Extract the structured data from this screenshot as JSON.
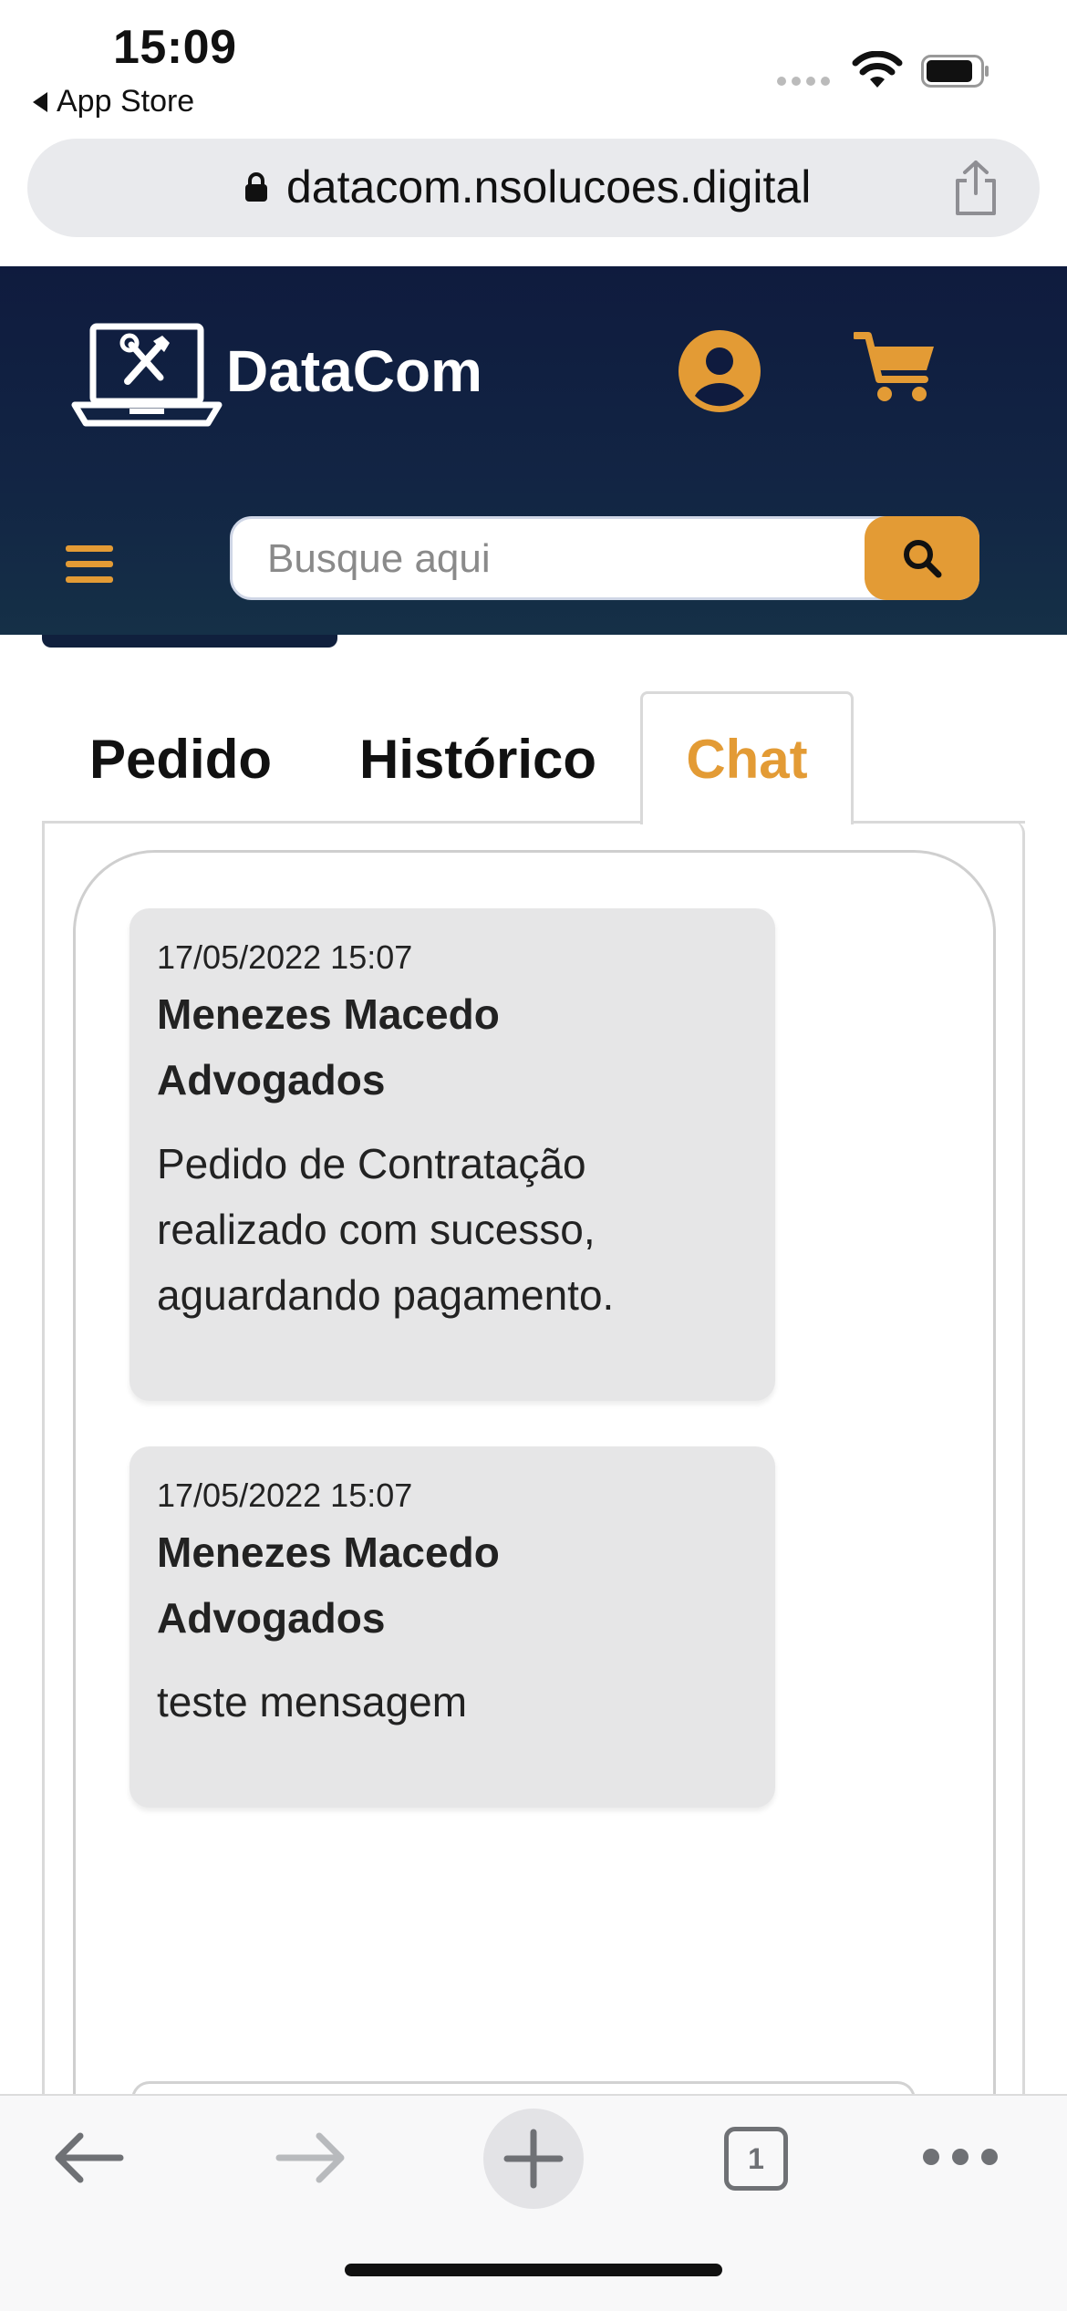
{
  "status_bar": {
    "time": "15:09",
    "back_app": "App Store"
  },
  "browser": {
    "url": "datacom.nsolucoes.digital",
    "tab_count": "1"
  },
  "header": {
    "brand": "DataCom",
    "search_placeholder": "Busque aqui",
    "accent_color": "#e39b35",
    "background_color": "#0f1b3e"
  },
  "tabs": [
    {
      "label": "Pedido",
      "active": false
    },
    {
      "label": "Histórico",
      "active": false
    },
    {
      "label": "Chat",
      "active": true
    }
  ],
  "messages": [
    {
      "date": "17/05/2022 15:07",
      "author": "Menezes Macedo Advogados",
      "text": "Pedido de Contratação realizado com sucesso, aguardando pagamento."
    },
    {
      "date": "17/05/2022 15:07",
      "author": "Menezes Macedo Advogados",
      "text": "teste mensagem"
    }
  ]
}
